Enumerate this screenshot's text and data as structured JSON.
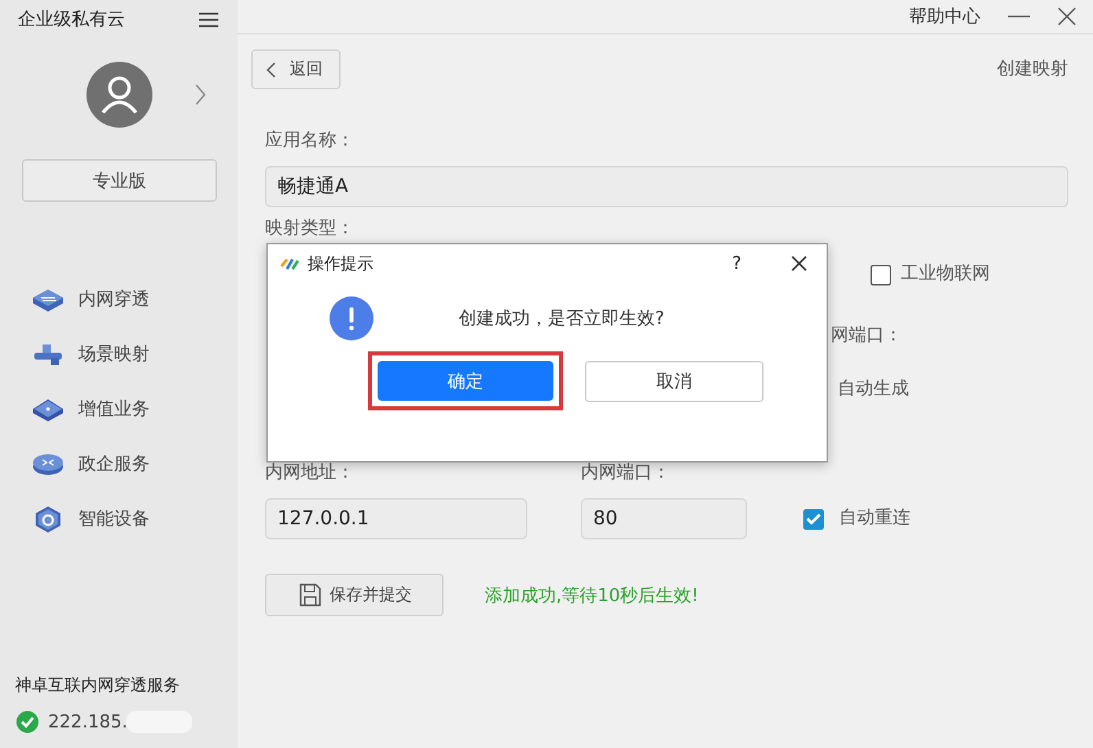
{
  "window": {
    "help": "帮助中心"
  },
  "sidebar": {
    "title": "企业级私有云",
    "edition": "专业版",
    "nav": [
      {
        "label": "内网穿透",
        "kind": "switch"
      },
      {
        "label": "场景映射",
        "kind": "usb"
      },
      {
        "label": "增值业务",
        "kind": "box"
      },
      {
        "label": "政企服务",
        "kind": "router"
      },
      {
        "label": "智能设备",
        "kind": "device"
      }
    ],
    "service": "神卓互联内网穿透服务",
    "ip": "222.185."
  },
  "main": {
    "back": "返回",
    "page_title": "创建映射",
    "app_name_label": "应用名称：",
    "app_name": "畅捷通A",
    "mapping_type_label": "映射类型：",
    "iot": {
      "label": "工业物联网",
      "checked": false
    },
    "port_label": "网端口：",
    "auto_generate": "自动生成",
    "lan_address_label": "内网地址：",
    "lan_address": "127.0.0.1",
    "lan_port_label": "内网端口：",
    "lan_port": "80",
    "reconnect": {
      "label": "自动重连",
      "checked": true
    },
    "save": "保存并提交",
    "status": "添加成功,等待10秒后生效!"
  },
  "dialog": {
    "title": "操作提示",
    "help": "?",
    "message": "创建成功，是否立即生效?",
    "confirm": "确定",
    "cancel": "取消"
  }
}
